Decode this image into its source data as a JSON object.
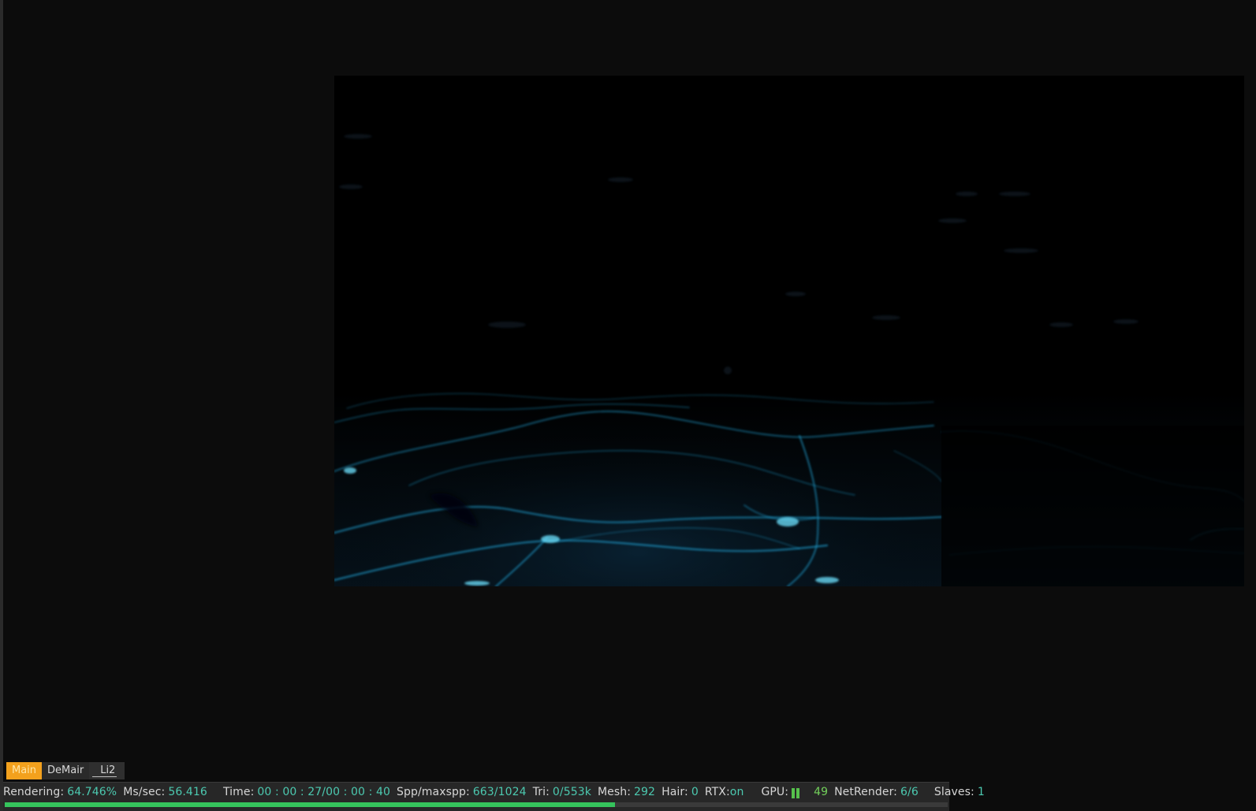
{
  "tabs": [
    {
      "label": "Main",
      "active": true
    },
    {
      "label": "DeMair",
      "active": false
    },
    {
      "label": "Li2",
      "active": false
    }
  ],
  "status": {
    "rendering": {
      "label": "Rendering:",
      "value": "64.746%"
    },
    "mssec": {
      "label": "Ms/sec:",
      "value": "56.416"
    },
    "time": {
      "label": "Time:",
      "value": "00 : 00 : 27/00 : 00 : 40"
    },
    "spp": {
      "label": "Spp/maxspp:",
      "value": "663/1024"
    },
    "tri": {
      "label": "Tri:",
      "value": "0/553k"
    },
    "mesh": {
      "label": "Mesh:",
      "value": "292"
    },
    "hair": {
      "label": "Hair:",
      "value": "0"
    },
    "rtx": {
      "label": "RTX:",
      "value": "on"
    },
    "gpu": {
      "label": "GPU:",
      "value": "49"
    },
    "netrender": {
      "label": "NetRender:",
      "value": "6/6"
    },
    "slaves": {
      "label": "Slaves:",
      "value": "1"
    }
  },
  "progress": {
    "fraction": 0.64746
  },
  "colors": {
    "app_background": "#0c0c0c",
    "viewport_background": "#000000",
    "active_tab": "#f3a11d",
    "status_bar": "#272727",
    "status_value": "#4cc9b0",
    "progress_fill": "#35c35c",
    "water_caustic": "#1d96c5"
  },
  "icons": {
    "gpu_status": "gpu-status-icon"
  }
}
